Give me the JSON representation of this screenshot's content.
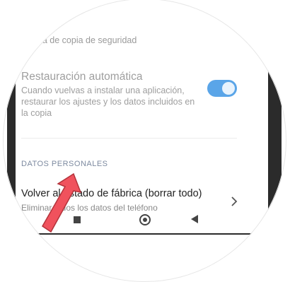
{
  "settings": {
    "top_description": "…enta de copia de seguridad",
    "auto_restore": {
      "title": "Restauración automática",
      "description": "Cuando vuelvas a instalar una aplicación, restaurar los ajustes y los datos incluidos en la copia",
      "toggle_state": "on"
    },
    "section_header": "DATOS PERSONALES",
    "factory_reset": {
      "title": "Volver al estado de fábrica (borrar todo)",
      "subtitle": "Eliminar todos los datos del teléfono"
    }
  },
  "colors": {
    "toggle_on": "#5aa5e8",
    "arrow": "#f0525d",
    "section_header": "#7d8aa0"
  },
  "icons": {
    "chevron": "chevron-right-icon",
    "nav_recents": "square-icon",
    "nav_home": "circle-icon",
    "nav_back": "triangle-back-icon",
    "pointer": "red-arrow-icon"
  }
}
